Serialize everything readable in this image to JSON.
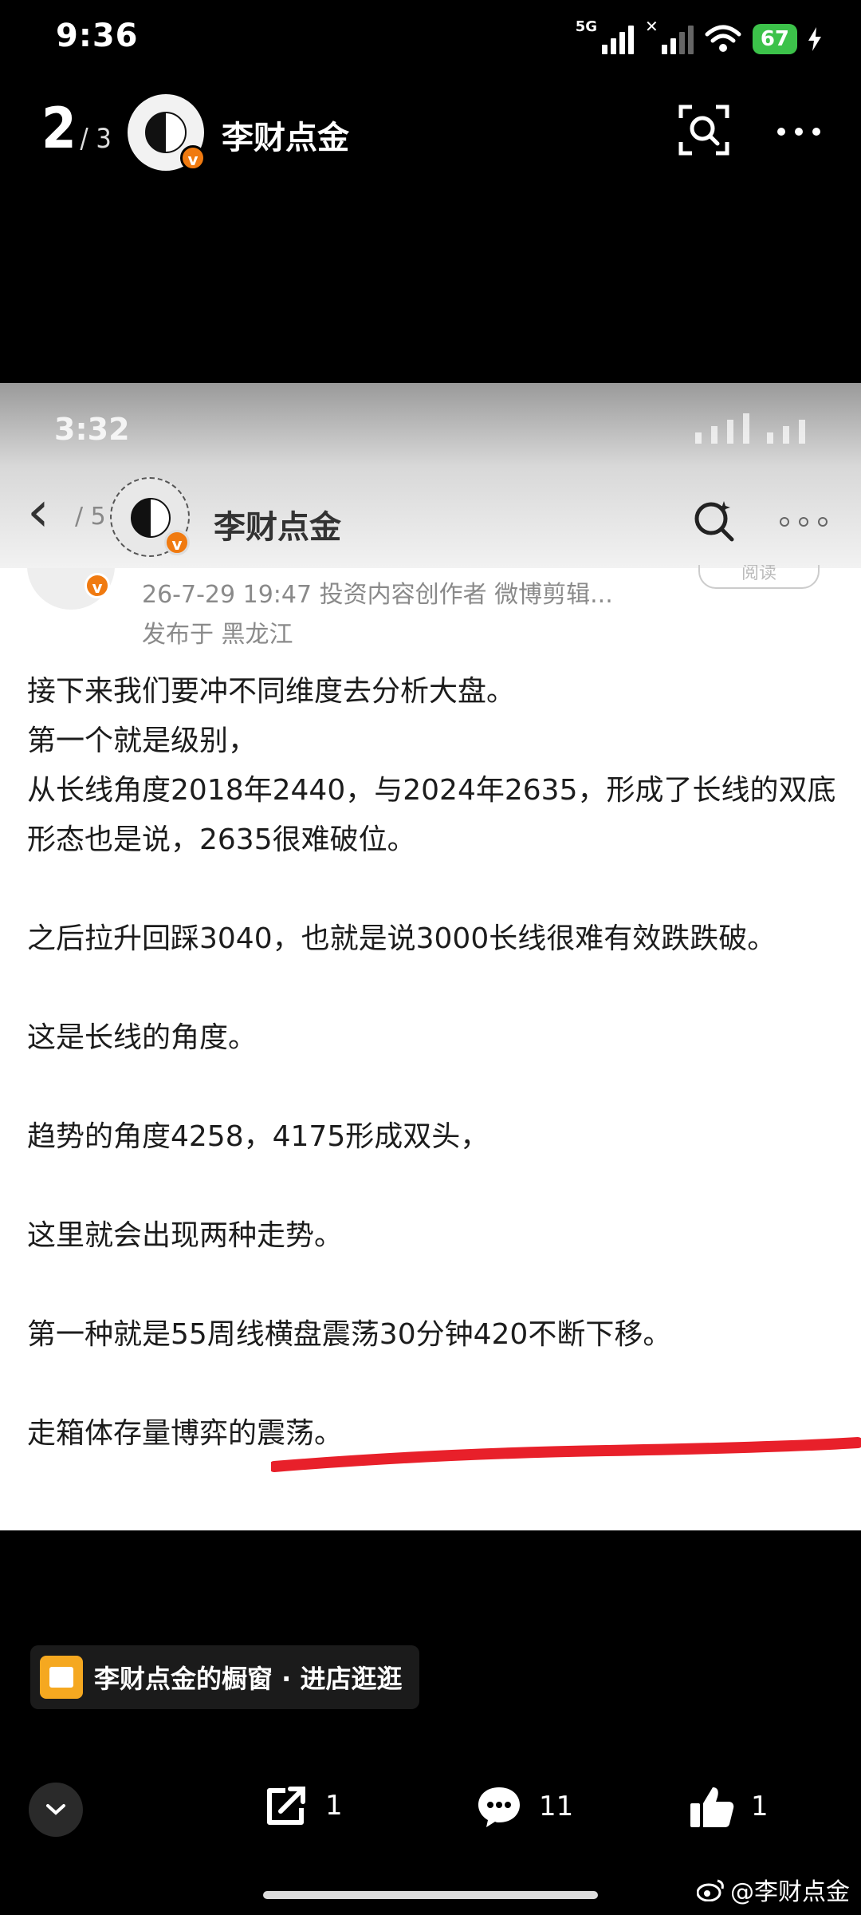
{
  "status_bar": {
    "time": "9:36",
    "network": "5G",
    "battery": "67"
  },
  "header": {
    "page_current": "2",
    "page_total": "/ 3",
    "author": "李财点金"
  },
  "inner_screenshot": {
    "ghost_time": "3:32",
    "ghost_page": "/ 5",
    "ghost_author": "李财点金",
    "post_meta": "26-7-29 19:47  投资内容创作者 微博剪辑...",
    "post_location": "发布于 黑龙江",
    "follow_label": "阅读",
    "paragraphs": [
      "接下来我们要冲不同维度去分析大盘。",
      "第一个就是级别，",
      "从长线角度2018年2440，与2024年2635，形成了长线的双底形态也是说，2635很难破位。",
      "",
      "之后拉升回踩3040，也就是说3000长线很难有效跌跌破。",
      "",
      "这是长线的角度。",
      "",
      "趋势的角度4258，4175形成双头，",
      "",
      "这里就会出现两种走势。",
      "",
      "第一种就是55周线横盘震荡30分钟420不断下移。",
      "",
      "走箱体存量博弈的震荡。"
    ]
  },
  "store_bar": {
    "label": "李财点金的橱窗 · 进店逛逛"
  },
  "actions": {
    "share_count": "1",
    "comment_count": "11",
    "like_count": "1"
  },
  "watermark": "@李财点金",
  "colors": {
    "badge": "#f07a10",
    "battery": "#3cc24a",
    "store_icon": "#f5a820",
    "annotation": "#e8202a"
  }
}
